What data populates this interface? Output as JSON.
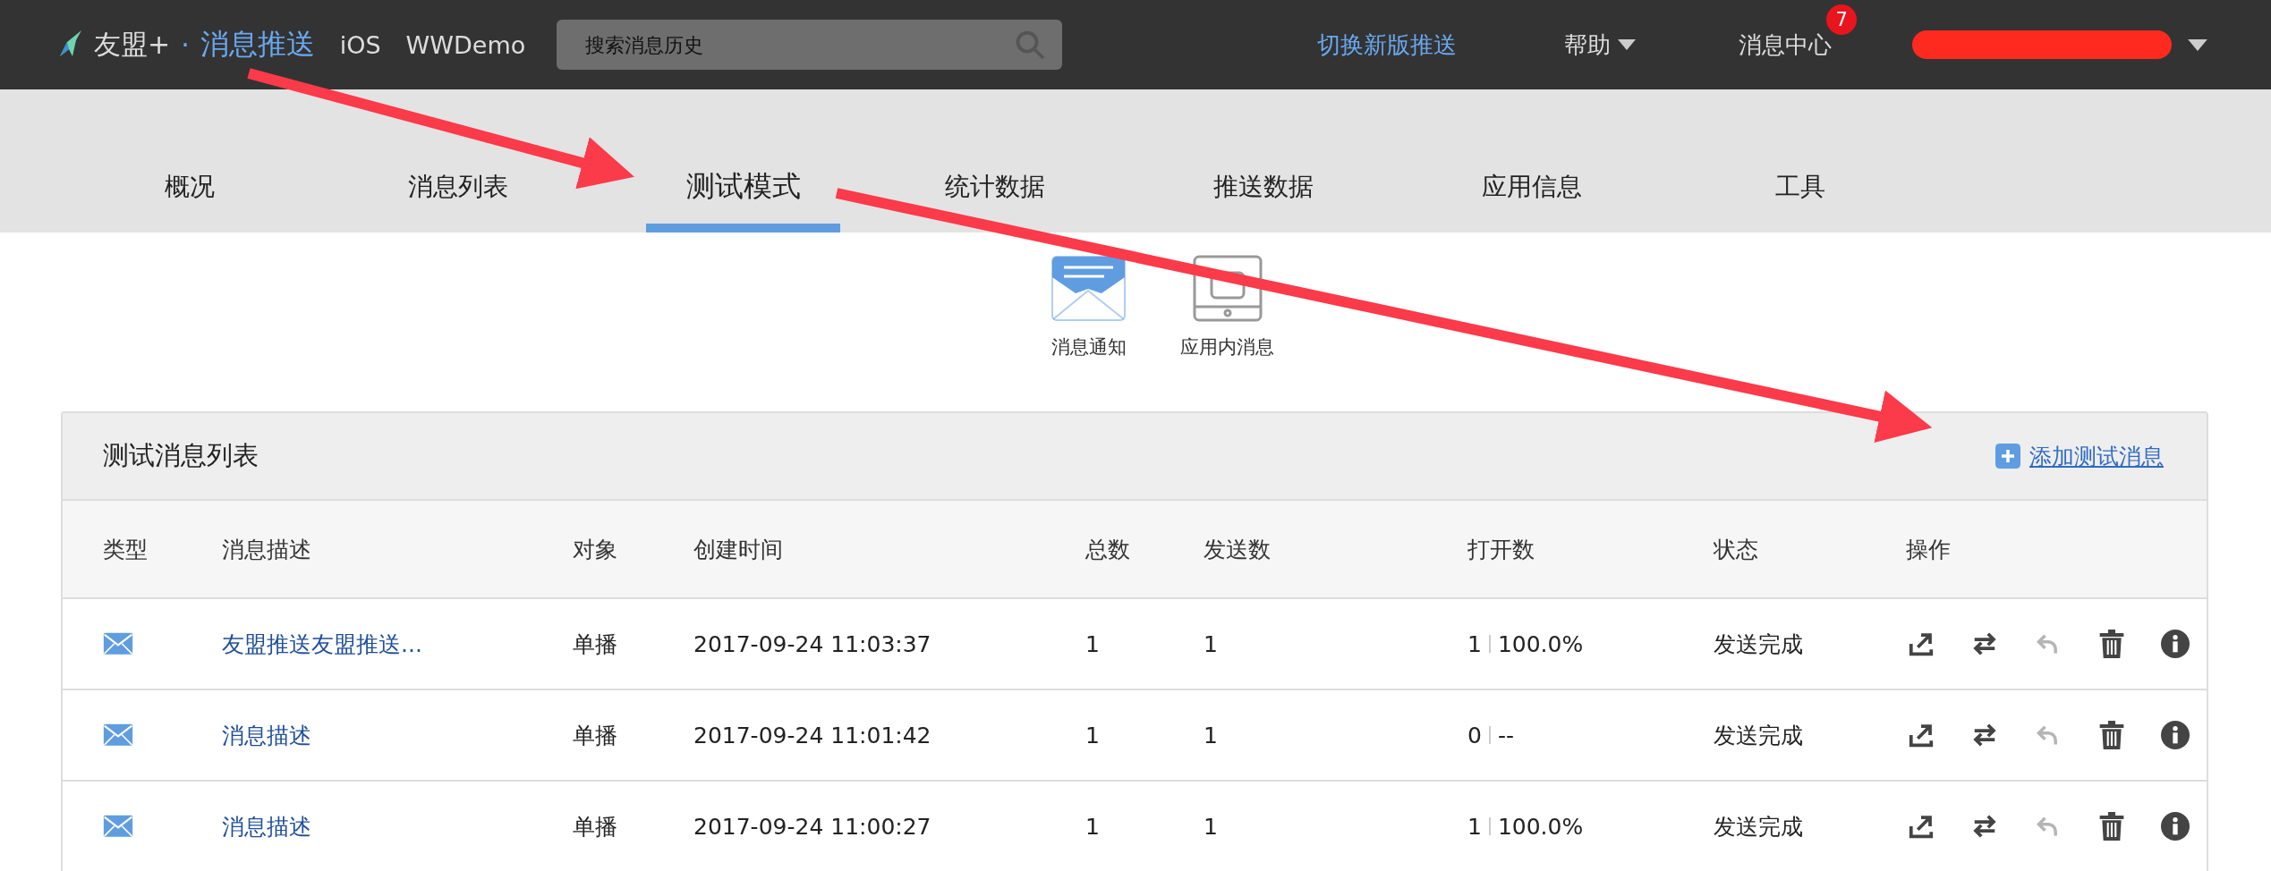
{
  "topbar": {
    "brand": "友盟+",
    "separator": "·",
    "product": "消息推送",
    "platform": "iOS",
    "app": "WWDemo",
    "search": {
      "placeholder": "搜索消息历史"
    },
    "switch_link": "切换新版推送",
    "help": "帮助",
    "messages": {
      "label": "消息中心",
      "badge": "7"
    }
  },
  "tabs": [
    {
      "label": "概况",
      "selected": false
    },
    {
      "label": "消息列表",
      "selected": false
    },
    {
      "label": "测试模式",
      "selected": true
    },
    {
      "label": "统计数据",
      "selected": false
    },
    {
      "label": "推送数据",
      "selected": false
    },
    {
      "label": "应用信息",
      "selected": false
    },
    {
      "label": "工具",
      "selected": false
    }
  ],
  "message_types": [
    {
      "kind": "notification",
      "label": "消息通知",
      "selected": true
    },
    {
      "kind": "in_app",
      "label": "应用内消息",
      "selected": false
    }
  ],
  "panel": {
    "title": "测试消息列表",
    "add_link": "添加测试消息",
    "columns": [
      "类型",
      "消息描述",
      "对象",
      "创建时间",
      "总数",
      "发送数",
      "打开数",
      "状态",
      "操作"
    ],
    "rows": [
      {
        "description": "友盟推送友盟推送...",
        "target": "单播",
        "created": "2017-09-24 11:03:37",
        "total": "1",
        "sent": "1",
        "opened": "1",
        "open_rate": "100.0%",
        "status": "发送完成",
        "actions": [
          {
            "kind": "export",
            "disabled": false
          },
          {
            "kind": "swap",
            "disabled": false
          },
          {
            "kind": "undo",
            "disabled": true
          },
          {
            "kind": "delete",
            "disabled": false
          },
          {
            "kind": "info",
            "disabled": false
          }
        ]
      },
      {
        "description": "消息描述",
        "target": "单播",
        "created": "2017-09-24 11:01:42",
        "total": "1",
        "sent": "1",
        "opened": "0",
        "open_rate": "--",
        "status": "发送完成",
        "actions": [
          {
            "kind": "export",
            "disabled": false
          },
          {
            "kind": "swap",
            "disabled": false
          },
          {
            "kind": "undo",
            "disabled": true
          },
          {
            "kind": "delete",
            "disabled": false
          },
          {
            "kind": "info",
            "disabled": false
          }
        ]
      },
      {
        "description": "消息描述",
        "target": "单播",
        "created": "2017-09-24 11:00:27",
        "total": "1",
        "sent": "1",
        "opened": "1",
        "open_rate": "100.0%",
        "status": "发送完成",
        "actions": [
          {
            "kind": "export",
            "disabled": false
          },
          {
            "kind": "swap",
            "disabled": false
          },
          {
            "kind": "undo",
            "disabled": true
          },
          {
            "kind": "delete",
            "disabled": false
          },
          {
            "kind": "info",
            "disabled": false
          }
        ]
      }
    ]
  }
}
